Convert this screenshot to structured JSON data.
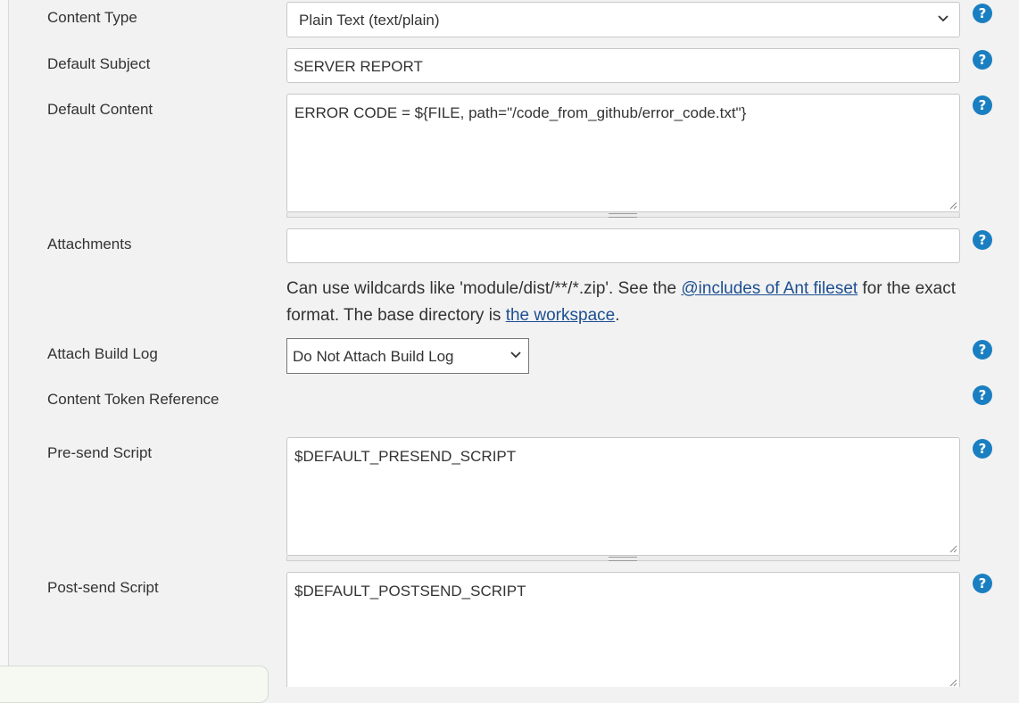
{
  "fields": {
    "content_type": {
      "label": "Content Type",
      "value": "Plain Text (text/plain)"
    },
    "default_subject": {
      "label": "Default Subject",
      "value": "SERVER REPORT"
    },
    "default_content": {
      "label": "Default Content",
      "value": "ERROR CODE = ${FILE, path=\"/code_from_github/error_code.txt\"}"
    },
    "attachments": {
      "label": "Attachments",
      "value": "",
      "help_prefix": "Can use wildcards like 'module/dist/**/*.zip'. See the ",
      "help_link1": "@includes of Ant fileset",
      "help_middle": " for the exact format. The base directory is ",
      "help_link2": "the workspace",
      "help_suffix": "."
    },
    "attach_build_log": {
      "label": "Attach Build Log",
      "value": "Do Not Attach Build Log"
    },
    "content_token_reference": {
      "label": "Content Token Reference"
    },
    "pre_send_script": {
      "label": "Pre-send Script",
      "value": "$DEFAULT_PRESEND_SCRIPT"
    },
    "post_send_script": {
      "label": "Post-send Script",
      "value": "$DEFAULT_POSTSEND_SCRIPT"
    }
  },
  "icons": {
    "help": "help-icon",
    "help_glyph": "?"
  },
  "colors": {
    "accent": "#1a7fc1",
    "link": "#1d4f91",
    "background": "#f2f2f2"
  }
}
